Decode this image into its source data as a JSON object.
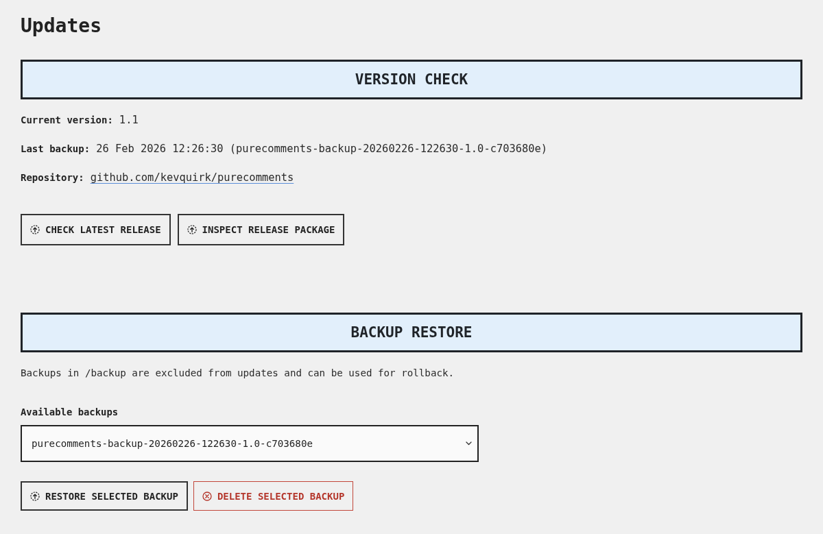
{
  "page": {
    "title": "Updates"
  },
  "sections": [
    {
      "heading": "VERSION CHECK",
      "fields": [
        {
          "label": "Current version:",
          "value": "1.1",
          "kind": "text"
        },
        {
          "label": "Last backup:",
          "value": "26 Feb 2026 12:26:30 (purecomments-backup-20260226-122630-1.0-c703680e)",
          "kind": "text"
        },
        {
          "label": "Repository:",
          "value": "github.com/kevquirk/purecomments",
          "kind": "link"
        }
      ],
      "buttons": [
        {
          "label": "CHECK LATEST RELEASE",
          "kind": "default"
        },
        {
          "label": "INSPECT RELEASE PACKAGE",
          "kind": "default"
        }
      ]
    },
    {
      "heading": "BACKUP RESTORE",
      "description": "Backups in /backup are excluded from updates and can be used for rollback.",
      "select": {
        "label": "Available backups",
        "value": "purecomments-backup-20260226-122630-1.0-c703680e"
      },
      "buttons": [
        {
          "label": "RESTORE SELECTED BACKUP",
          "kind": "default"
        },
        {
          "label": "DELETE SELECTED BACKUP",
          "kind": "danger"
        }
      ]
    }
  ]
}
